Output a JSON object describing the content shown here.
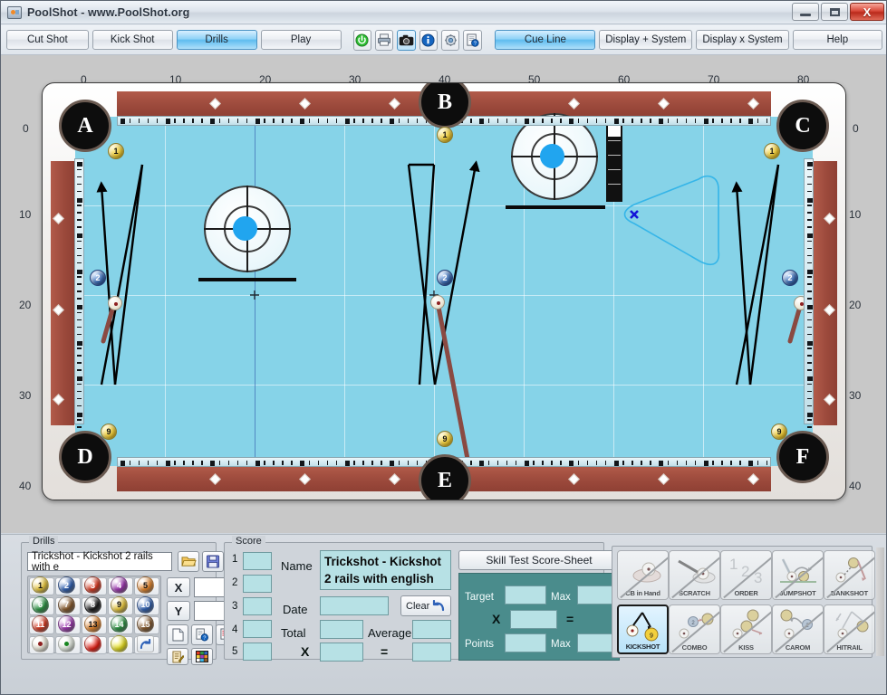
{
  "window": {
    "title": "PoolShot - www.PoolShot.org",
    "icon": "app-icon",
    "minimize": "",
    "maximize": "",
    "close": "X"
  },
  "toolbar": {
    "buttons": [
      {
        "label": "Cut Shot",
        "active": false
      },
      {
        "label": "Kick Shot",
        "active": false
      },
      {
        "label": "Drills",
        "active": true
      },
      {
        "label": "Play",
        "active": false
      }
    ],
    "icons": [
      {
        "name": "power-icon",
        "glyph": "⏻",
        "selected": false
      },
      {
        "name": "printer-icon",
        "glyph": "⎙",
        "selected": false
      },
      {
        "name": "camera-icon",
        "glyph": "▣",
        "selected": true
      },
      {
        "name": "info-icon",
        "glyph": "i",
        "selected": false
      },
      {
        "name": "settings-gear-icon",
        "glyph": "⚙",
        "selected": false
      },
      {
        "name": "help-document-icon",
        "glyph": "?",
        "selected": false
      }
    ],
    "right_buttons": [
      {
        "label": "Cue Line",
        "active": true
      },
      {
        "label": "Display + System",
        "active": false
      },
      {
        "label": "Display x System",
        "active": false
      },
      {
        "label": "Help",
        "active": false
      }
    ]
  },
  "table": {
    "x_axis_labels": [
      "0",
      "10",
      "20",
      "30",
      "40",
      "50",
      "60",
      "70",
      "80"
    ],
    "y_axis_labels": [
      "0",
      "10",
      "20",
      "30",
      "40"
    ],
    "pockets": [
      {
        "id": "A",
        "label": "A"
      },
      {
        "id": "B",
        "label": "B"
      },
      {
        "id": "C",
        "label": "C"
      },
      {
        "id": "D",
        "label": "D"
      },
      {
        "id": "E",
        "label": "E"
      },
      {
        "id": "F",
        "label": "F"
      }
    ],
    "ball_markers": [
      {
        "label": "1",
        "color": "yellow"
      },
      {
        "label": "2",
        "color": "blue"
      },
      {
        "label": "9",
        "color": "yellow"
      },
      {
        "label": "1",
        "color": "yellow"
      },
      {
        "label": "2",
        "color": "blue"
      },
      {
        "label": "9",
        "color": "yellow"
      },
      {
        "label": "1",
        "color": "yellow"
      },
      {
        "label": "2",
        "color": "blue"
      },
      {
        "label": "9",
        "color": "yellow"
      }
    ],
    "felt_color": "#86d3e8",
    "rail_color": "#9c4a3c"
  },
  "drills": {
    "legend": "Drills",
    "selected_drill": "Trickshot - Kickshot 2 rails with e",
    "open_icon": "folder-open-icon",
    "save_icon": "floppy-save-icon",
    "balls": [
      {
        "num": "1",
        "color": "#f2cf3c",
        "text": "#111"
      },
      {
        "num": "2",
        "color": "#2f62b8",
        "text": "#fff"
      },
      {
        "num": "3",
        "color": "#e03a21",
        "text": "#fff"
      },
      {
        "num": "4",
        "color": "#a437b8",
        "text": "#fff"
      },
      {
        "num": "5",
        "color": "#ef8a2a",
        "text": "#111"
      },
      {
        "num": "6",
        "color": "#2c9a44",
        "text": "#fff"
      },
      {
        "num": "7",
        "color": "#8a5a2b",
        "text": "#fff"
      },
      {
        "num": "8",
        "color": "#191919",
        "text": "#fff"
      },
      {
        "num": "9",
        "color": "#f2cf3c",
        "text": "#111"
      },
      {
        "num": "10",
        "color": "#2f62b8",
        "text": "#fff"
      },
      {
        "num": "11",
        "color": "#e03a21",
        "text": "#fff"
      },
      {
        "num": "12",
        "color": "#a437b8",
        "text": "#fff"
      },
      {
        "num": "13",
        "color": "#ef8a2a",
        "text": "#111"
      },
      {
        "num": "14",
        "color": "#2c9a44",
        "text": "#fff"
      },
      {
        "num": "15",
        "color": "#8a5a2b",
        "text": "#fff"
      }
    ],
    "special_balls": [
      {
        "name": "cue-ball-red-dot",
        "color": "#f6f2e2"
      },
      {
        "name": "cue-ball-green-dot",
        "color": "#eef5ea"
      },
      {
        "name": "red-ball",
        "color": "#f01a0f"
      },
      {
        "name": "yellow-ball",
        "color": "#f0e81a"
      },
      {
        "name": "undo-arrow",
        "color": "#e8edf2"
      }
    ],
    "x_label": "X",
    "y_label": "Y",
    "x_value": "",
    "y_value": "",
    "tool_icons": [
      {
        "name": "new-document-icon"
      },
      {
        "name": "document-help-icon"
      },
      {
        "name": "table-settings-icon"
      },
      {
        "name": "edit-notes-icon"
      },
      {
        "name": "color-palette-icon"
      }
    ]
  },
  "score": {
    "legend": "Score",
    "rows": [
      "1",
      "2",
      "3",
      "4",
      "5"
    ],
    "row_values": [
      "",
      "",
      "",
      "",
      ""
    ],
    "name_label": "Name",
    "name_value": "Trickshot - Kickshot 2 rails with english",
    "date_label": "Date",
    "date_value": "",
    "clear_label": "Clear",
    "clear_icon": "undo-arrow-icon",
    "total_label": "Total",
    "total_value": "",
    "average_label": "Average",
    "average_value": "",
    "x_label": "X",
    "x_value": "",
    "equals_label": "=",
    "equals_value": ""
  },
  "skill_sheet": {
    "title": "Skill Test Score-Sheet",
    "target_label": "Target",
    "target_value": "",
    "target_max_label": "Max",
    "target_max_value": "",
    "multiply_label": "X",
    "multiply_value": "",
    "equals_label": "=",
    "equals_value": "",
    "points_label": "Points",
    "points_value": "",
    "points_max_label": "Max",
    "points_max_value": ""
  },
  "shot_types": [
    {
      "label": "CB in Hand",
      "name": "cb-in-hand",
      "on": false,
      "disabled": true
    },
    {
      "label": "SCRATCH",
      "name": "scratch",
      "on": false,
      "disabled": true
    },
    {
      "label": "ORDER",
      "name": "order",
      "on": false,
      "disabled": true
    },
    {
      "label": "JUMPSHOT",
      "name": "jumpshot",
      "on": false,
      "disabled": true
    },
    {
      "label": "BANKSHOT",
      "name": "bankshot",
      "on": false,
      "disabled": true
    },
    {
      "label": "KICKSHOT",
      "name": "kickshot",
      "on": true,
      "disabled": false
    },
    {
      "label": "COMBO",
      "name": "combo",
      "on": false,
      "disabled": true
    },
    {
      "label": "KISS",
      "name": "kiss",
      "on": false,
      "disabled": true
    },
    {
      "label": "CAROM",
      "name": "carom",
      "on": false,
      "disabled": true
    },
    {
      "label": "HITRAIL",
      "name": "hitrail",
      "on": false,
      "disabled": true
    }
  ]
}
